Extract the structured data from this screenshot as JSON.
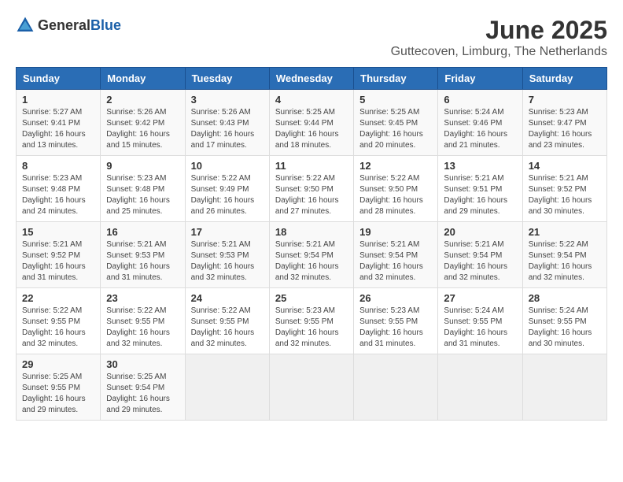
{
  "logo": {
    "general": "General",
    "blue": "Blue"
  },
  "title": "June 2025",
  "location": "Guttecoven, Limburg, The Netherlands",
  "weekdays": [
    "Sunday",
    "Monday",
    "Tuesday",
    "Wednesday",
    "Thursday",
    "Friday",
    "Saturday"
  ],
  "weeks": [
    [
      {
        "day": "1",
        "sunrise": "5:27 AM",
        "sunset": "9:41 PM",
        "daylight": "16 hours and 13 minutes."
      },
      {
        "day": "2",
        "sunrise": "5:26 AM",
        "sunset": "9:42 PM",
        "daylight": "16 hours and 15 minutes."
      },
      {
        "day": "3",
        "sunrise": "5:26 AM",
        "sunset": "9:43 PM",
        "daylight": "16 hours and 17 minutes."
      },
      {
        "day": "4",
        "sunrise": "5:25 AM",
        "sunset": "9:44 PM",
        "daylight": "16 hours and 18 minutes."
      },
      {
        "day": "5",
        "sunrise": "5:25 AM",
        "sunset": "9:45 PM",
        "daylight": "16 hours and 20 minutes."
      },
      {
        "day": "6",
        "sunrise": "5:24 AM",
        "sunset": "9:46 PM",
        "daylight": "16 hours and 21 minutes."
      },
      {
        "day": "7",
        "sunrise": "5:23 AM",
        "sunset": "9:47 PM",
        "daylight": "16 hours and 23 minutes."
      }
    ],
    [
      {
        "day": "8",
        "sunrise": "5:23 AM",
        "sunset": "9:48 PM",
        "daylight": "16 hours and 24 minutes."
      },
      {
        "day": "9",
        "sunrise": "5:23 AM",
        "sunset": "9:48 PM",
        "daylight": "16 hours and 25 minutes."
      },
      {
        "day": "10",
        "sunrise": "5:22 AM",
        "sunset": "9:49 PM",
        "daylight": "16 hours and 26 minutes."
      },
      {
        "day": "11",
        "sunrise": "5:22 AM",
        "sunset": "9:50 PM",
        "daylight": "16 hours and 27 minutes."
      },
      {
        "day": "12",
        "sunrise": "5:22 AM",
        "sunset": "9:50 PM",
        "daylight": "16 hours and 28 minutes."
      },
      {
        "day": "13",
        "sunrise": "5:21 AM",
        "sunset": "9:51 PM",
        "daylight": "16 hours and 29 minutes."
      },
      {
        "day": "14",
        "sunrise": "5:21 AM",
        "sunset": "9:52 PM",
        "daylight": "16 hours and 30 minutes."
      }
    ],
    [
      {
        "day": "15",
        "sunrise": "5:21 AM",
        "sunset": "9:52 PM",
        "daylight": "16 hours and 31 minutes."
      },
      {
        "day": "16",
        "sunrise": "5:21 AM",
        "sunset": "9:53 PM",
        "daylight": "16 hours and 31 minutes."
      },
      {
        "day": "17",
        "sunrise": "5:21 AM",
        "sunset": "9:53 PM",
        "daylight": "16 hours and 32 minutes."
      },
      {
        "day": "18",
        "sunrise": "5:21 AM",
        "sunset": "9:54 PM",
        "daylight": "16 hours and 32 minutes."
      },
      {
        "day": "19",
        "sunrise": "5:21 AM",
        "sunset": "9:54 PM",
        "daylight": "16 hours and 32 minutes."
      },
      {
        "day": "20",
        "sunrise": "5:21 AM",
        "sunset": "9:54 PM",
        "daylight": "16 hours and 32 minutes."
      },
      {
        "day": "21",
        "sunrise": "5:22 AM",
        "sunset": "9:54 PM",
        "daylight": "16 hours and 32 minutes."
      }
    ],
    [
      {
        "day": "22",
        "sunrise": "5:22 AM",
        "sunset": "9:55 PM",
        "daylight": "16 hours and 32 minutes."
      },
      {
        "day": "23",
        "sunrise": "5:22 AM",
        "sunset": "9:55 PM",
        "daylight": "16 hours and 32 minutes."
      },
      {
        "day": "24",
        "sunrise": "5:22 AM",
        "sunset": "9:55 PM",
        "daylight": "16 hours and 32 minutes."
      },
      {
        "day": "25",
        "sunrise": "5:23 AM",
        "sunset": "9:55 PM",
        "daylight": "16 hours and 32 minutes."
      },
      {
        "day": "26",
        "sunrise": "5:23 AM",
        "sunset": "9:55 PM",
        "daylight": "16 hours and 31 minutes."
      },
      {
        "day": "27",
        "sunrise": "5:24 AM",
        "sunset": "9:55 PM",
        "daylight": "16 hours and 31 minutes."
      },
      {
        "day": "28",
        "sunrise": "5:24 AM",
        "sunset": "9:55 PM",
        "daylight": "16 hours and 30 minutes."
      }
    ],
    [
      {
        "day": "29",
        "sunrise": "5:25 AM",
        "sunset": "9:55 PM",
        "daylight": "16 hours and 29 minutes."
      },
      {
        "day": "30",
        "sunrise": "5:25 AM",
        "sunset": "9:54 PM",
        "daylight": "16 hours and 29 minutes."
      },
      null,
      null,
      null,
      null,
      null
    ]
  ]
}
